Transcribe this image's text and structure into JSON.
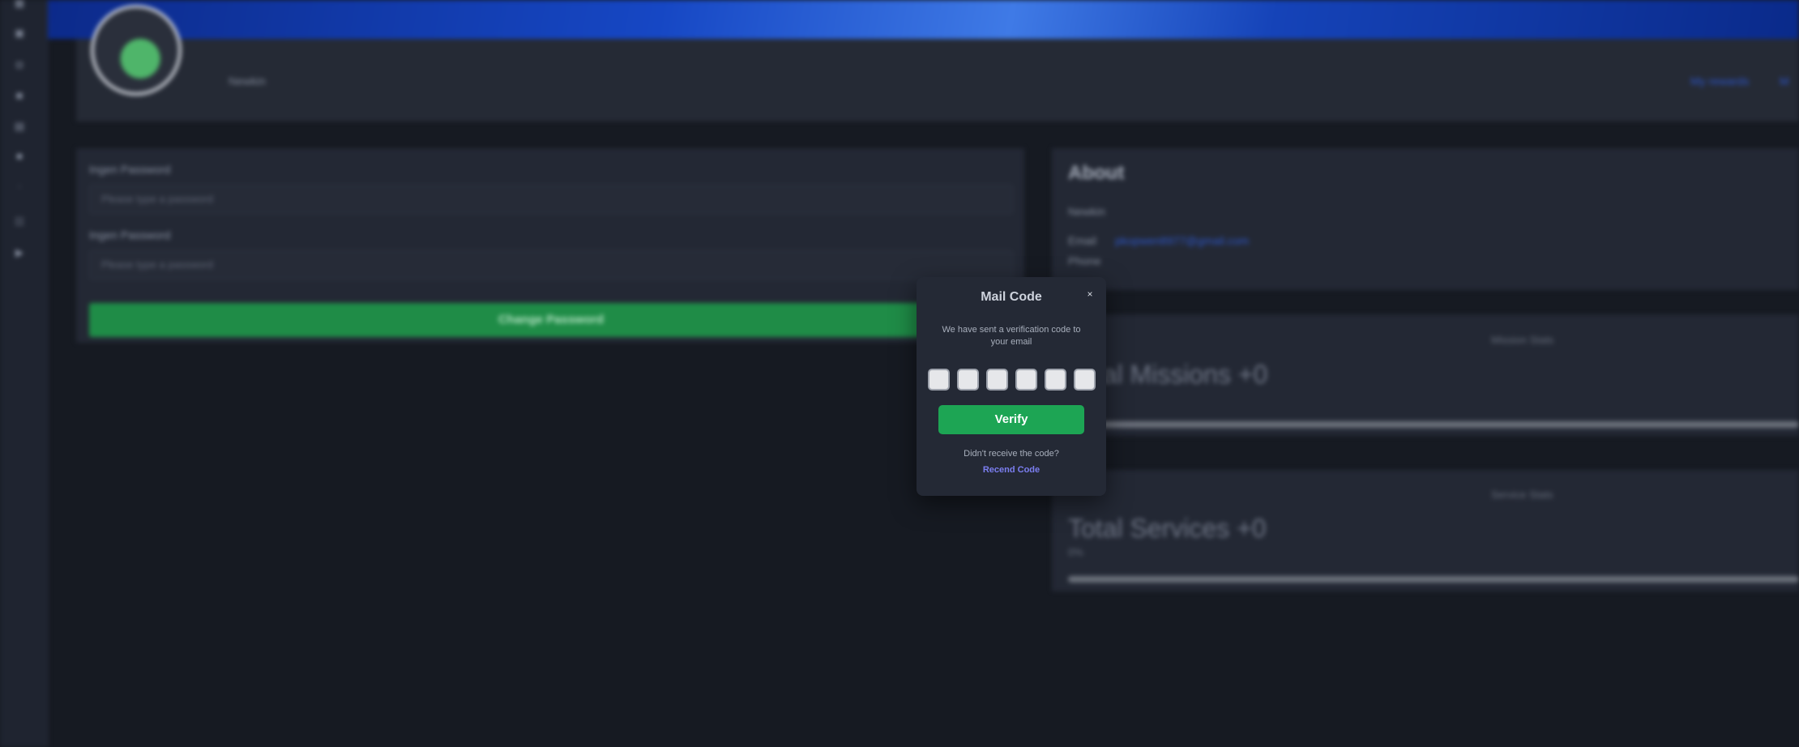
{
  "sidebar": {
    "icons": [
      "grid-icon",
      "contacts-icon",
      "camera-icon",
      "wallet-icon",
      "calendar-icon",
      "lock-icon",
      "dot-icon",
      "team-icon",
      "youtube-icon"
    ]
  },
  "profile": {
    "name": "Newkin",
    "links": [
      "My rewards",
      "M"
    ]
  },
  "password_form": {
    "new_label": "Ingen Password",
    "new_placeholder": "Please type a password",
    "confirm_label": "Ingen Password",
    "confirm_placeholder": "Please type a password",
    "submit_label": "Change Password"
  },
  "about": {
    "title": "About",
    "username": "Newkin",
    "email_label": "Email",
    "email_value": "pkopwen8977@gmail.com",
    "phone_label": "Phone"
  },
  "stats": {
    "missions_head": "Mission Stats",
    "missions_value": "Total Missions +0",
    "services_head": "Service Stats",
    "services_value": "Total Services +0",
    "services_sub": "0%"
  },
  "modal": {
    "title": "Mail Code",
    "close": "×",
    "message": "We have sent a verification code to your email",
    "code_slots": [
      "",
      "",
      "",
      "",
      "",
      ""
    ],
    "verify_label": "Verify",
    "question": "Didn't receive the code?",
    "resend_label": "Recend Code"
  },
  "colors": {
    "verify": "#1da554",
    "resend_link": "#7b7ef0",
    "modal_bg": "#242935"
  }
}
